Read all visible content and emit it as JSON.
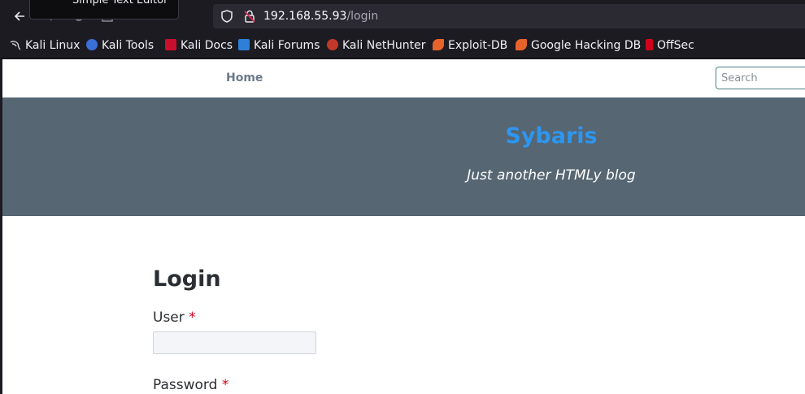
{
  "browser": {
    "tooltip": "Simple Text Editor",
    "url_host": "192.168.55.93",
    "url_path": "/login",
    "bookmarks": [
      {
        "label": "Kali Linux",
        "color": "#9aa0a6"
      },
      {
        "label": "Kali Tools",
        "color": "#3b6fd8"
      },
      {
        "label": "Kali Docs",
        "color": "#c8102e"
      },
      {
        "label": "Kali Forums",
        "color": "#2f7fd8"
      },
      {
        "label": "Kali NetHunter",
        "color": "#c0392b"
      },
      {
        "label": "Exploit-DB",
        "color": "#e8632b"
      },
      {
        "label": "Google Hacking DB",
        "color": "#e8632b"
      },
      {
        "label": "OffSec",
        "color": "#d0021b"
      }
    ]
  },
  "nav": {
    "home_label": "Home",
    "search_placeholder": "Search"
  },
  "hero": {
    "title": "Sybaris",
    "tagline": "Just another HTMLy blog"
  },
  "login": {
    "heading": "Login",
    "user_label": "User",
    "password_label": "Password",
    "required_mark": "*"
  }
}
